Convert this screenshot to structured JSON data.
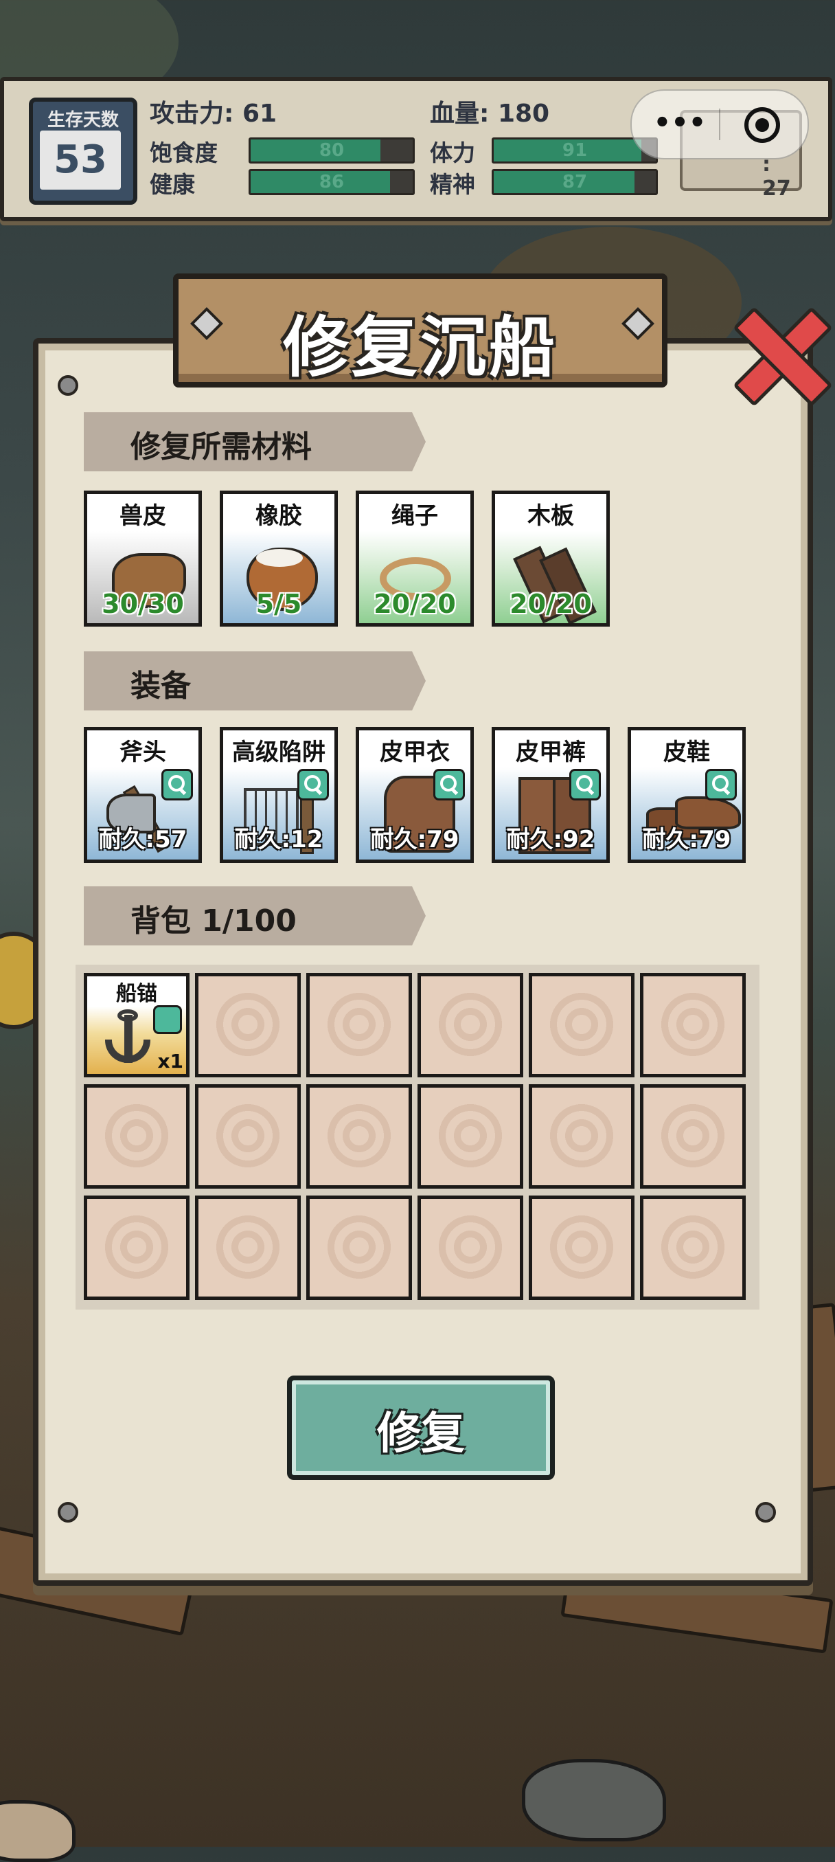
{
  "hud": {
    "survival_days_label": "生存天数",
    "survival_days_value": "53",
    "attack_label": "攻击力",
    "attack_value": "61",
    "hp_label": "血量",
    "hp_value": "180",
    "stats": [
      {
        "key": "satiety",
        "label": "饱食度",
        "value": 80,
        "max": 100
      },
      {
        "key": "health",
        "label": "健康",
        "value": 86,
        "max": 100
      },
      {
        "key": "stamina",
        "label": "体力",
        "value": 91,
        "max": 100
      },
      {
        "key": "spirit",
        "label": "精神",
        "value": 87,
        "max": 100
      }
    ],
    "temperature_partial": ": 27",
    "bar_fill_color": "#2f8a66"
  },
  "panel": {
    "title": "修复沉船",
    "materials_section": "修复所需材料",
    "materials": [
      {
        "name": "兽皮",
        "qty": "30/30",
        "icon": "hide-icon"
      },
      {
        "name": "橡胶",
        "qty": "5/5",
        "icon": "rubber-bowl-icon"
      },
      {
        "name": "绳子",
        "qty": "20/20",
        "icon": "rope-icon"
      },
      {
        "name": "木板",
        "qty": "20/20",
        "icon": "planks-icon"
      }
    ],
    "equipment_section": "装备",
    "equipment": [
      {
        "name": "斧头",
        "durability": "耐久:57",
        "icon": "axe-icon"
      },
      {
        "name": "高级陷阱",
        "durability": "耐久:12",
        "icon": "trap-icon"
      },
      {
        "name": "皮甲衣",
        "durability": "耐久:79",
        "icon": "leather-armor-icon"
      },
      {
        "name": "皮甲裤",
        "durability": "耐久:92",
        "icon": "leather-pants-icon"
      },
      {
        "name": "皮鞋",
        "durability": "耐久:79",
        "icon": "leather-shoes-icon"
      }
    ],
    "backpack_section": "背包 1/100",
    "backpack_items": [
      {
        "name": "船锚",
        "count": "x1",
        "icon": "anchor-icon"
      }
    ],
    "repair_button": "修复"
  },
  "colors": {
    "panel_bg": "#e9e3d2",
    "qty_green": "#2c8a2c",
    "button_teal": "#6eae9e",
    "close_red": "#e04a4a"
  }
}
